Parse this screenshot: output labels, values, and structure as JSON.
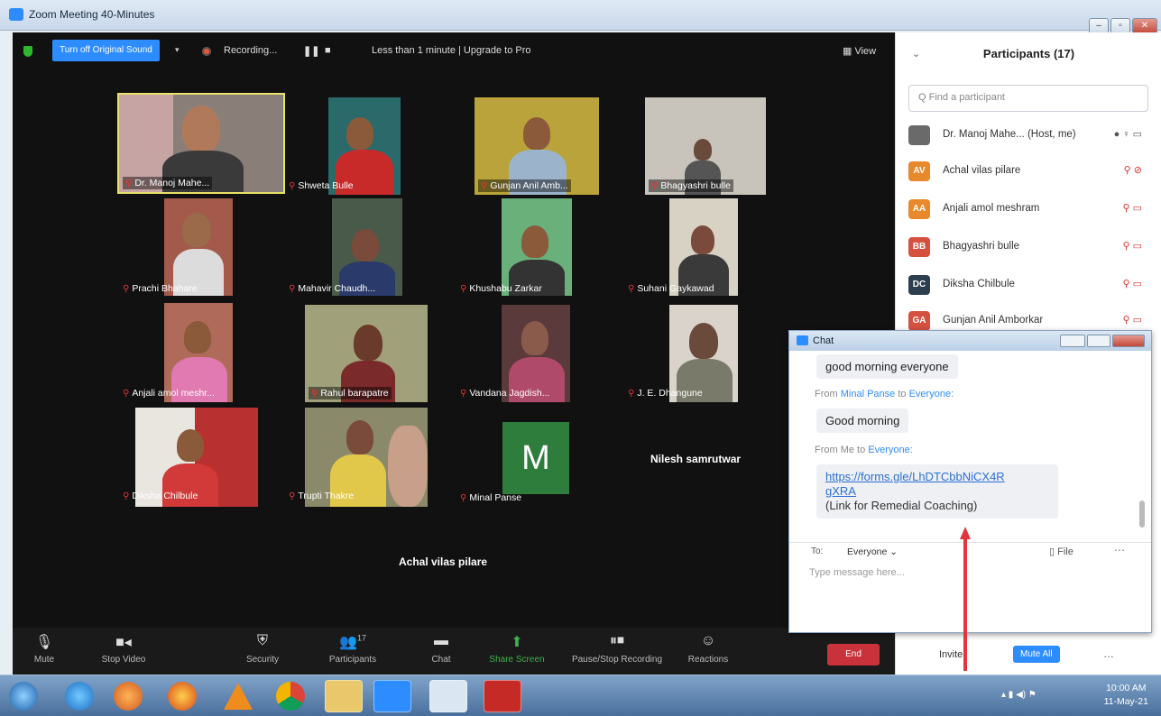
{
  "window": {
    "title": "Zoom Meeting 40-Minutes"
  },
  "meeting_bar": {
    "original_sound": "Turn off Original Sound",
    "recording": "Recording...",
    "timer": "Less than 1 minute | Upgrade to Pro",
    "view": "View"
  },
  "tiles": [
    {
      "name": "Dr. Manoj Mahe..."
    },
    {
      "name": "Shweta Bulle"
    },
    {
      "name": "Gunjan Anil Amb..."
    },
    {
      "name": "Bhagyashri bulle"
    },
    {
      "name": "Prachi Bhahare"
    },
    {
      "name": "Mahavir Chaudh..."
    },
    {
      "name": "Khushabu Zarkar"
    },
    {
      "name": "Suhani Gaykawad"
    },
    {
      "name": "Anjali amol meshr..."
    },
    {
      "name": "Rahul barapatre"
    },
    {
      "name": "Vandana Jagdish..."
    },
    {
      "name": "J. E. Dhangune"
    },
    {
      "name": "Diksha Chilbule"
    },
    {
      "name": "Trupti Thakre"
    },
    {
      "name": "Minal Panse",
      "avatar_letter": "M"
    }
  ],
  "name_only": {
    "nilesh": "Nilesh samrutwar",
    "achal": "Achal vilas pilare"
  },
  "toolbar": {
    "mute": "Mute",
    "stop_video": "Stop Video",
    "security": "Security",
    "participants": "Participants",
    "participant_count": "17",
    "chat": "Chat",
    "share_screen": "Share Screen",
    "pause_stop_recording": "Pause/Stop Recording",
    "reactions": "Reactions",
    "end": "End"
  },
  "participants_panel": {
    "title": "Participants (17)",
    "search_placeholder": "Q Find a participant",
    "rows": [
      {
        "initials": "",
        "name": "Dr. Manoj Mahe... (Host, me)",
        "color": "#555555"
      },
      {
        "initials": "AV",
        "name": "Achal vilas pilare",
        "color": "#e8892b"
      },
      {
        "initials": "AA",
        "name": "Anjali amol meshram",
        "color": "#e8892b"
      },
      {
        "initials": "BB",
        "name": "Bhagyashri bulle",
        "color": "#d6503f"
      },
      {
        "initials": "DC",
        "name": "Diksha Chilbule",
        "color": "#2d3e50"
      },
      {
        "initials": "GA",
        "name": "Gunjan Anil Amborkar",
        "color": "#d6503f"
      }
    ],
    "invite": "Invite",
    "mute_all": "Mute All"
  },
  "chat": {
    "title": "Chat",
    "msg1": "good morning everyone",
    "from2_prefix": "From",
    "from2_sender": "Minal Panse",
    "from2_to": "to",
    "from2_target": "Everyone:",
    "msg2": "Good morning",
    "from3_prefix": "From Me to",
    "from3_target": "Everyone:",
    "link_line1": "https://forms.gle/LhDTCbbNiCX4R",
    "link_line2": "gXRA",
    "link_note": "(Link for  Remedial Coaching)",
    "to_label": "To:",
    "to_value": "Everyone",
    "file": "File",
    "placeholder": "Type message here..."
  },
  "taskbar": {
    "time": "10:00 AM",
    "date": "11-May-21"
  }
}
